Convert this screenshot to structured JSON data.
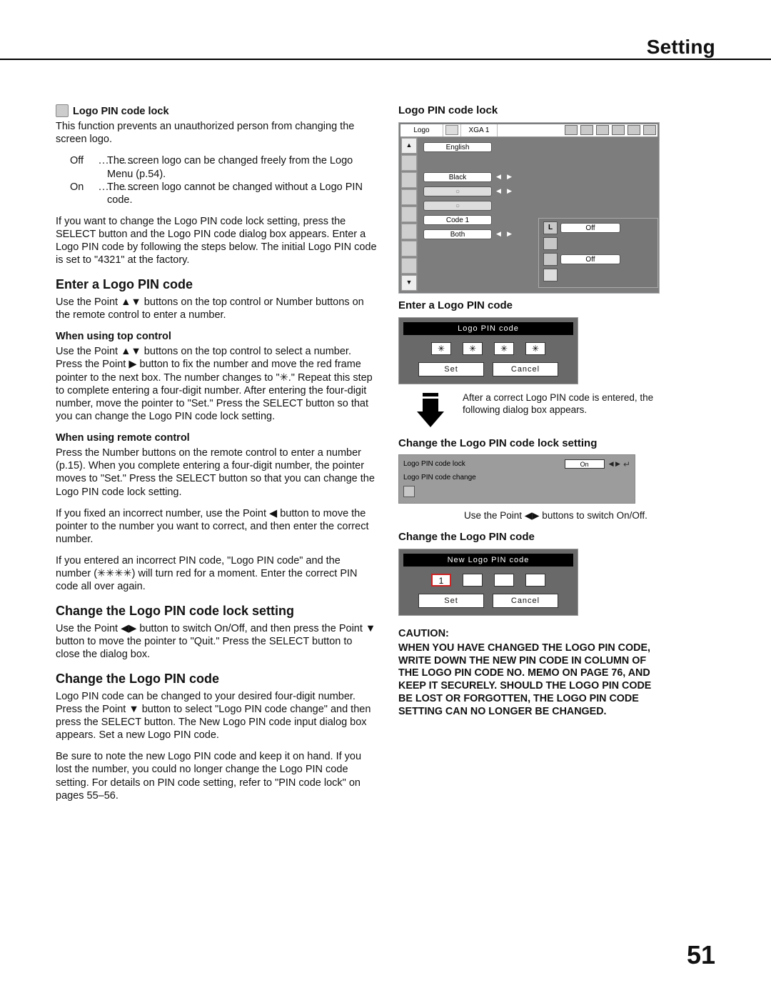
{
  "masthead": "Setting",
  "pageNumber": "51",
  "left": {
    "h_lock": "Logo PIN code lock",
    "p_lock": "This function prevents an unauthorized person from changing the screen logo.",
    "off_k": "Off",
    "off_v": "The screen logo can be changed freely from the Logo Menu (p.54).",
    "on_k": "On",
    "on_v": "The screen logo cannot be changed without a Logo PIN code.",
    "p_change": "If you want to change the Logo PIN code lock setting, press the SELECT button and the Logo PIN code dialog box appears. Enter a Logo PIN code by following the steps below. The initial Logo PIN code is set to \"4321\" at the factory.",
    "h_enter": "Enter a Logo PIN code",
    "p_enter": "Use the Point ▲▼ buttons on the top control or Number buttons on the remote control to enter a number.",
    "h_top": "When using top control",
    "p_top": "Use the Point ▲▼ buttons on the top control to select a number. Press the Point ▶ button to fix the number and move the red frame pointer to the next box. The number changes to \"✳.\" Repeat this step to complete entering a four-digit number. After entering the four-digit number, move the pointer to \"Set.\" Press the SELECT button so that you can change the Logo PIN code lock setting.",
    "h_remote": "When using remote control",
    "p_remote": "Press the Number buttons on the remote control to enter a number (p.15). When you complete entering a four-digit number, the pointer moves to \"Set.\" Press the SELECT button so that you can change the Logo PIN code lock setting.",
    "p_fix": "If you fixed an incorrect number, use the Point ◀ button to move the pointer to the number you want to correct, and then enter the correct number.",
    "p_wrong": "If you entered an incorrect PIN code, \"Logo PIN code\" and the number (✳✳✳✳) will turn red for a moment. Enter the correct PIN code all over again.",
    "h_chlock": "Change the Logo PIN code lock setting",
    "p_chlock": "Use the Point ◀▶ button to switch On/Off, and then press the Point ▼ button to move the pointer to \"Quit.\" Press the SELECT button to close the dialog box.",
    "h_chpin": "Change the Logo PIN code",
    "p_chpin1": "Logo PIN code can be changed to your desired four-digit number. Press the Point ▼ button to select \"Logo PIN code change\" and then press the SELECT button. The New Logo PIN code input dialog box appears. Set a new Logo PIN code.",
    "p_chpin2": "Be sure to note the new Logo PIN code and keep it on hand. If you lost the number, you could no longer change the Logo PIN code setting. For details on PIN code setting, refer to \"PIN code lock\" on pages 55–56."
  },
  "right": {
    "h_lock": "Logo PIN code lock",
    "osd": {
      "tab": "Logo",
      "mode": "XGA 1",
      "english": "English",
      "black": "Black",
      "code1": "Code 1",
      "both": "Both",
      "off1": "Off",
      "off2": "Off"
    },
    "h_enter": "Enter a Logo PIN code",
    "dlg1": {
      "title": "Logo PIN code",
      "star": "✳",
      "set": "Set",
      "cancel": "Cancel"
    },
    "arrow_note": "After a correct Logo PIN code is entered, the following dialog box appears.",
    "h_chlock": "Change the Logo PIN code lock setting",
    "lockpanel": {
      "row1": "Logo PIN code lock",
      "val": "On",
      "row2": "Logo PIN code change"
    },
    "switch_note": "Use the Point ◀▶ buttons to switch On/Off.",
    "h_chpin": "Change the Logo PIN code",
    "dlg2": {
      "title": "New Logo PIN code",
      "d1": "1",
      "set": "Set",
      "cancel": "Cancel"
    },
    "caution_h": "CAUTION:",
    "caution": "WHEN YOU HAVE CHANGED THE LOGO PIN CODE, WRITE DOWN THE NEW PIN CODE IN COLUMN OF THE LOGO PIN CODE NO. MEMO ON PAGE 76, AND KEEP IT SECURELY. SHOULD THE LOGO PIN CODE BE LOST OR FORGOTTEN, THE LOGO PIN CODE SETTING CAN NO LONGER BE CHANGED."
  }
}
